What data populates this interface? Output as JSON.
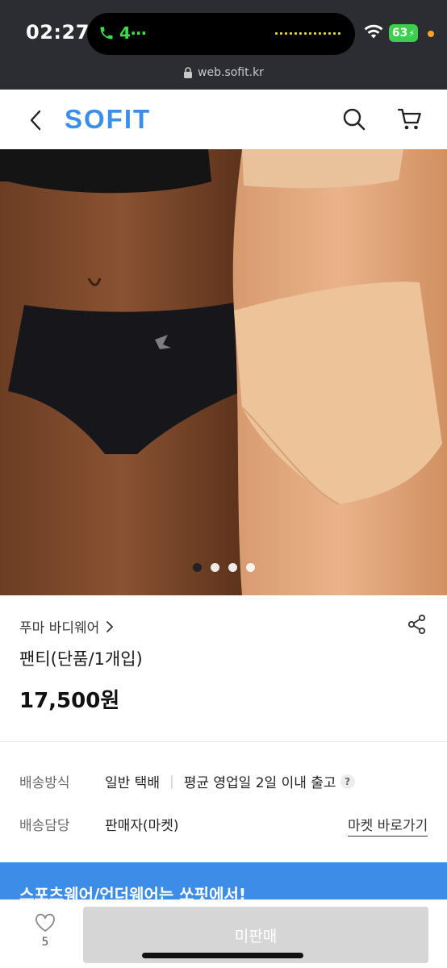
{
  "status_bar": {
    "time": "02:27",
    "call_indicator": "4⋯",
    "battery": "63",
    "icons": [
      "phone-icon",
      "wifi-icon",
      "battery-icon"
    ]
  },
  "browser": {
    "url": "web.sofit.kr"
  },
  "header": {
    "logo": "SOFIT",
    "icons": [
      "back-icon",
      "search-icon",
      "cart-icon"
    ]
  },
  "gallery": {
    "image_count": 4,
    "active_index": 0
  },
  "product": {
    "brand": "푸마 바디웨어",
    "name": "팬티(단품/1개입)",
    "price": "17,500원"
  },
  "shipping": {
    "method_label": "배송방식",
    "method_value": "일반 택배",
    "method_separator": "|",
    "method_note": "평균 영업일 2일 이내 출고",
    "help_mark": "?",
    "handler_label": "배송담당",
    "handler_value": "판매자(마켓)",
    "market_link": "마켓 바로가기"
  },
  "banner": {
    "text": "스포츠웨어/언더웨어는 쏘핏에서!",
    "color": "#3d8de6"
  },
  "bottom_bar": {
    "like_count": "5",
    "buy_label": "미판매"
  },
  "colors": {
    "brand": "#3b8fe8",
    "status_bar": "#2b2d32",
    "disabled_button": "#d6d6d6"
  }
}
